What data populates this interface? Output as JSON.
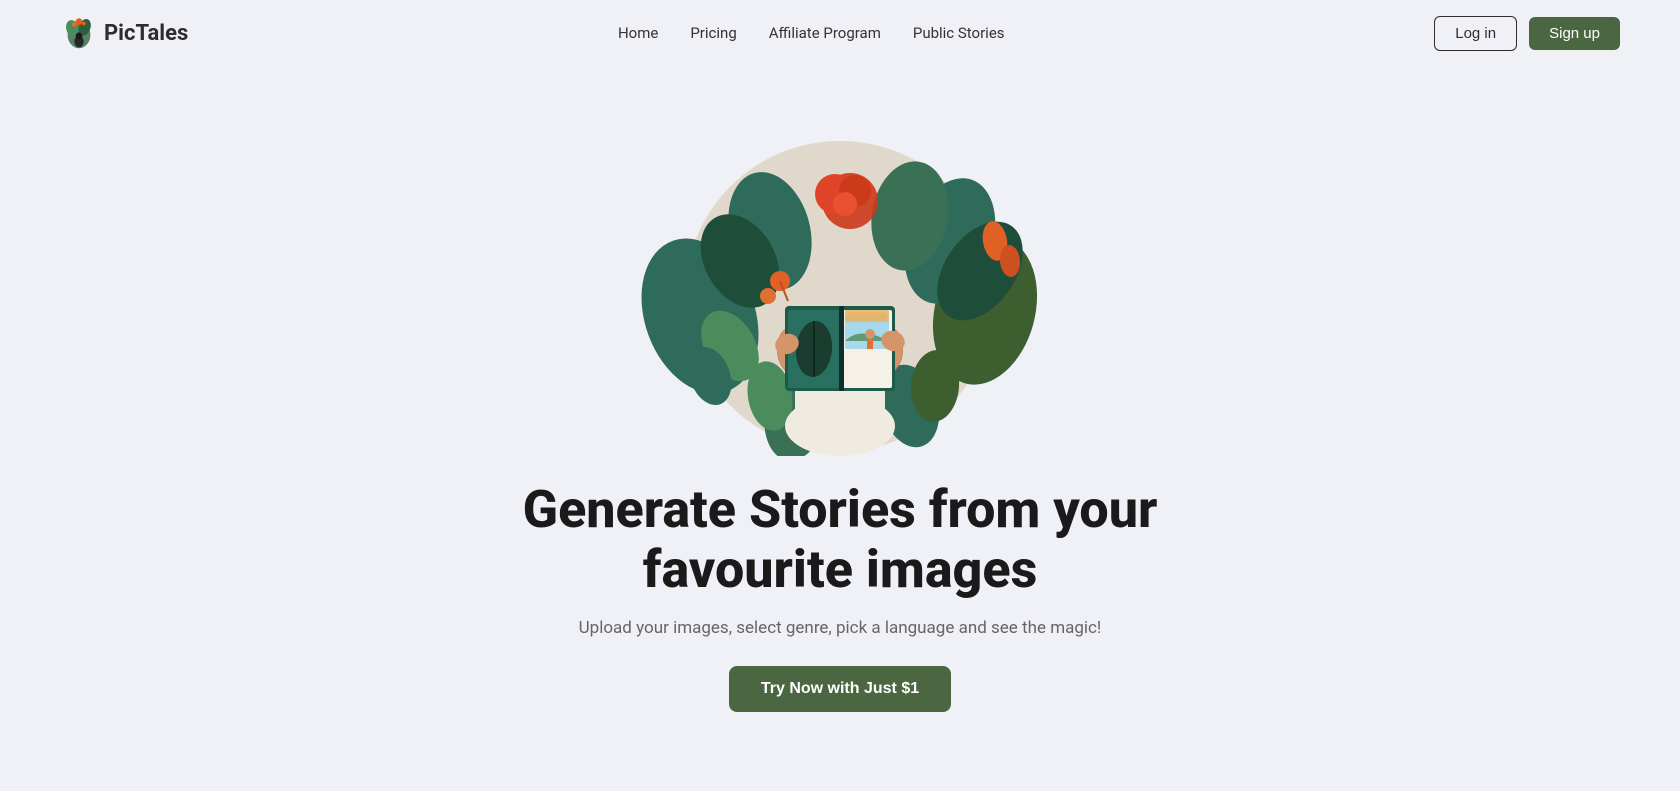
{
  "brand": {
    "logo_text": "PicTales",
    "logo_pic": "Pic",
    "logo_tales": "Tales"
  },
  "navbar": {
    "links": [
      {
        "label": "Home",
        "id": "home"
      },
      {
        "label": "Pricing",
        "id": "pricing"
      },
      {
        "label": "Affiliate Program",
        "id": "affiliate"
      },
      {
        "label": "Public Stories",
        "id": "public-stories"
      }
    ],
    "login_label": "Log in",
    "signup_label": "Sign up"
  },
  "hero": {
    "title_line1": "Generate Stories from your",
    "title_line2": "favourite images",
    "subtitle": "Upload your images, select genre, pick a language and see the magic!",
    "cta_label": "Try Now with Just $1"
  },
  "colors": {
    "accent": "#4a6741",
    "background": "#f0f0f7",
    "text_dark": "#1a1a1a",
    "text_muted": "#666"
  }
}
